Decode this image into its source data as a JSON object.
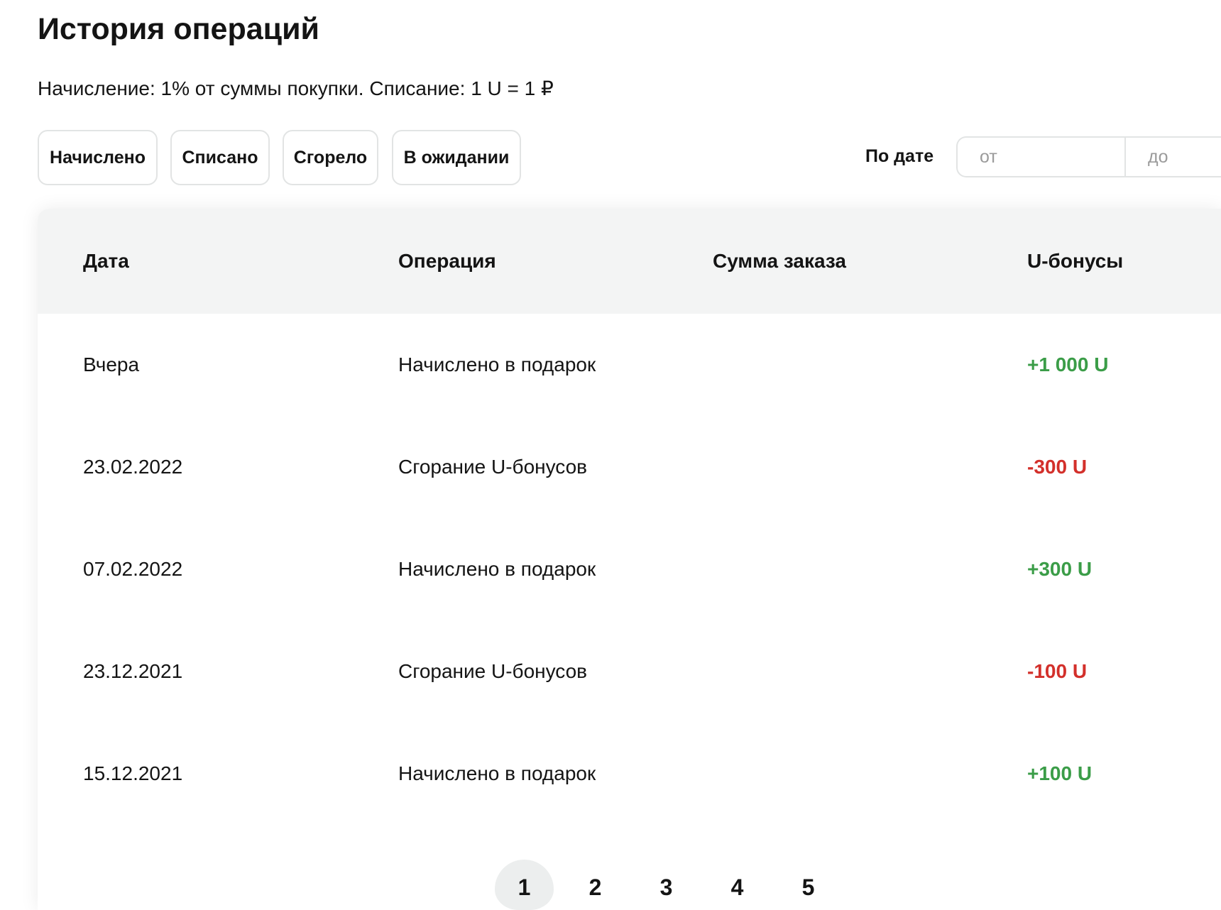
{
  "page": {
    "title": "История операций",
    "subtitle": "Начисление: 1% от суммы покупки. Списание: 1 U = 1 ₽"
  },
  "filters": [
    {
      "label": "Начислено"
    },
    {
      "label": "Списано"
    },
    {
      "label": "Сгорело"
    },
    {
      "label": "В ожидании"
    }
  ],
  "date_filter": {
    "label": "По дате",
    "from_placeholder": "от",
    "to_placeholder": "до"
  },
  "table": {
    "columns": {
      "date": "Дата",
      "operation": "Операция",
      "order_sum": "Сумма заказа",
      "bonus": "U-бонусы"
    },
    "rows": [
      {
        "date": "Вчера",
        "operation": "Начислено в подарок",
        "bonus": "+1 000 U",
        "bonus_color": "#3b9d48"
      },
      {
        "date": "23.02.2022",
        "operation": "Сгорание U-бонусов",
        "bonus": "-300 U",
        "bonus_color": "#d3302b"
      },
      {
        "date": "07.02.2022",
        "operation": "Начислено в подарок",
        "bonus": "+300 U",
        "bonus_color": "#3b9d48"
      },
      {
        "date": "23.12.2021",
        "operation": "Сгорание U-бонусов",
        "bonus": "-100 U",
        "bonus_color": "#d3302b"
      },
      {
        "date": "15.12.2021",
        "operation": "Начислено в подарок",
        "bonus": "+100 U",
        "bonus_color": "#3b9d48"
      }
    ]
  },
  "pagination": {
    "pages": [
      "1",
      "2",
      "3",
      "4",
      "5"
    ],
    "current_page": 1
  },
  "colors": {
    "header_bg": "#f3f4f4",
    "active_page_bg": "#eceeee",
    "credit": "#3b9d48",
    "debit": "#d3302b"
  }
}
